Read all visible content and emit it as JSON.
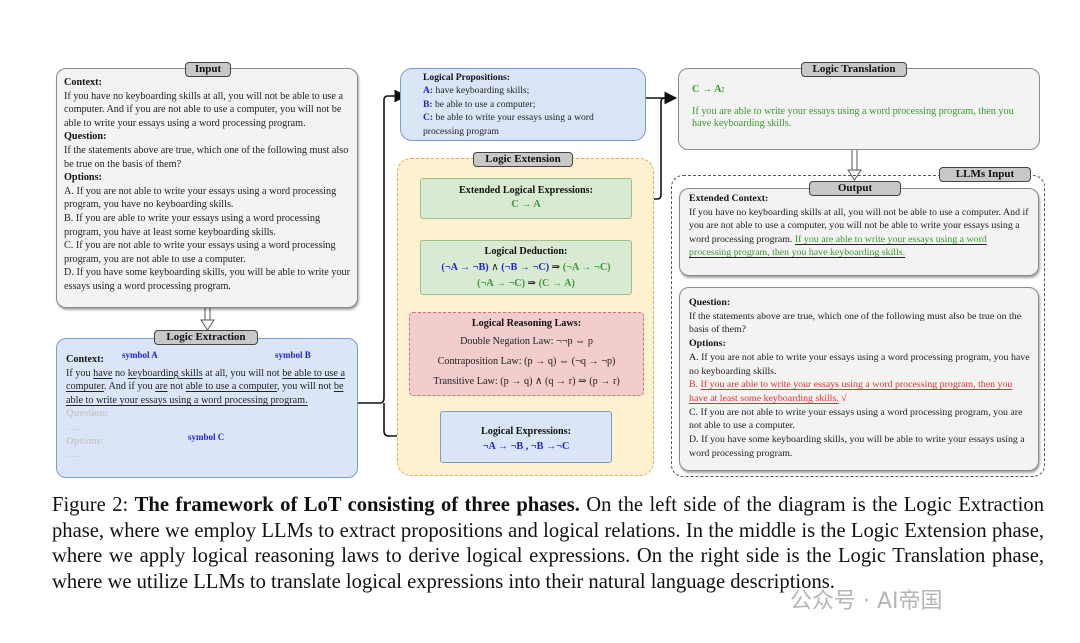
{
  "input": {
    "tag": "Input",
    "context_label": "Context:",
    "context": "If you have no keyboarding skills at all, you will not be able to use a computer. And if you are not able to use a computer, you will not be able to write your essays using a word processing program.",
    "question_label": "Question:",
    "question": "If the statements above are true, which one of the following must also be true on the basis of them?",
    "options_label": "Options:",
    "options": [
      "A. If you are not able to write your essays using a word processing program, you have no keyboarding skills.",
      "B. If you are able to write your essays using a word processing program, you have at least some keyboarding skills.",
      "C. If you are not able to write your essays using a word processing program, you are not able to use a computer.",
      "D. If you have some keyboarding skills, you will be able to write your essays using a word processing program."
    ]
  },
  "extraction": {
    "tag": "Logic Extraction",
    "context_label": "Context:",
    "t1": "If you ",
    "u1": "have",
    "t2": " no ",
    "u2": "keyboarding skills",
    "t3": " at all, you will not ",
    "u3": "be able to use a computer",
    "t4": ". And if you ",
    "u4": "are",
    "t5": " not ",
    "u5": "able to use a computer",
    "t6": ", you will not ",
    "u6": "be able to write your essays using a word processing program.",
    "question_label": "Question:",
    "ellipsis": "......",
    "options_label": "Options:",
    "symbol_a": "symbol A",
    "symbol_b": "symbol B",
    "symbol_c": "symbol C"
  },
  "propositions": {
    "title": "Logical Propositions:",
    "items": [
      {
        "key": "A:",
        "text": " have keyboarding skills;"
      },
      {
        "key": "B:",
        "text": " be able to use a computer;"
      },
      {
        "key": "C:",
        "text": " be able to write your essays using a word processing program"
      }
    ]
  },
  "extension": {
    "tag": "Logic Extension",
    "extended": {
      "title": "Extended Logical Expressions:",
      "expr": "C → A"
    },
    "deduction": {
      "title": "Logical Deduction:",
      "line1_blue1": "(¬A → ¬B)",
      "line1_and": " ∧ ",
      "line1_blue2": "(¬B → ¬C)",
      "line1_implies": " ⇒ ",
      "line1_green": "(¬A → ¬C)",
      "line2_green1": "(¬A → ¬C)",
      "line2_implies": " ⇒ ",
      "line2_green2": "(C → A)"
    },
    "laws": {
      "title": "Logical Reasoning Laws:",
      "items": [
        "Double Negation Law:  ¬¬p ⇔ p",
        "Contraposition Law: (p → q) ⇔ (¬q → ¬p)",
        "Transitive Law: (p → q) ∧ (q → r) ⇒ (p → r)"
      ]
    },
    "expressions": {
      "title": "Logical Expressions:",
      "expr": "¬A → ¬B , ¬B →¬C"
    }
  },
  "translation": {
    "tag": "Logic Translation",
    "expr": "C → A:",
    "text": "If you are able to write your essays using a word processing program, then you have keyboarding skills."
  },
  "llms_input": {
    "tag": "LLMs Input",
    "output_tag": "Output",
    "extended_context_label": "Extended Context:",
    "extended_context": "If you have no keyboarding skills at all, you will not be able to use a computer. And if you are not able to use a computer, you will not be able to write your essays using a word processing program. ",
    "extended_context_added": "If you are able to write your essays using a word processing program, then you have keyboarding skills.",
    "question_label": "Question:",
    "question": "If the statements above are true, which one of the following must also be true on the basis of them?",
    "options_label": "Options:",
    "option_a": "A. If you are not able to write your essays using a word processing program, you have no keyboarding skills.",
    "option_b_prefix": "B. ",
    "option_b": "If you are able to write your essays using a word processing program, then you have at least some keyboarding skills.",
    "option_b_check": " √",
    "option_c": "C. If you are not able to write your essays using a word processing program, you are not able to use a computer.",
    "option_d": "D. If you have some keyboarding skills, you will be able to write your essays using a word processing program."
  },
  "caption": {
    "prefix": "Figure 2: ",
    "bold": "The framework of LoT consisting of three phases.",
    "text": " On the left side of the diagram is the Logic Extraction phase, where we employ LLMs to extract propositions and logical relations. In the middle is the Logic Extension phase, where we apply logical reasoning laws to derive logical expressions. On the right side is the Logic Translation phase, where we utilize LLMs to translate logical expressions into their natural language descriptions."
  },
  "watermark": "公众号 · AI帝国",
  "colors": {
    "green_text": "#3a9a2f",
    "blue_text": "#1f1fd8",
    "red_text": "#e03030",
    "blue_box": "#dae6f8",
    "green_box": "#d9ead3",
    "red_box": "#f3cccc",
    "yellow_box": "#fdf1cf",
    "gray_box": "#f3f3f3"
  }
}
